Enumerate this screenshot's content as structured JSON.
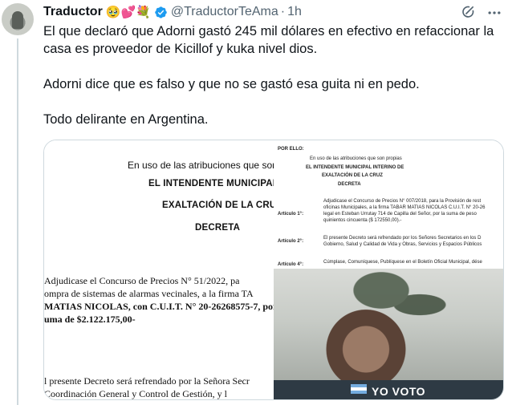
{
  "tweet": {
    "display_name": "Traductor",
    "name_emojis": "🥹💕💐",
    "handle": "@TraductorTeAma",
    "separator": "·",
    "time": "1h",
    "text": "El que declaró que Adorni gastó 245 mil dólares en efectivo en refaccionar la casa es proveedor de Kicillof y kuka nivel dios.\n\nAdorni dice que es falso y que no se gastó esa guita ni en pedo.\n\nTodo delirante en Argentina."
  },
  "media": {
    "left_doc": {
      "line1": "En uso de las atribuciones que son",
      "heading1": "EL INTENDENTE MUNICIPAL",
      "heading2": "EXALTACIÓN DE LA CRUZ",
      "heading3": "DECRETA",
      "body1": "Adjudicase el Concurso de Precios N° 51/2022, pa",
      "body2": "ompra de sistemas de alarmas vecinales, a la firma TA",
      "body3": "MATIAS NICOLAS, con C.U.I.T. N° 20-26268575-7, por",
      "body4": "uma de $2.122.175,00-",
      "body5": "l presente Decreto será refrendado por la Señora Secr",
      "body6": "Coordinación General y Control de Gestión, y l"
    },
    "right_doc": {
      "por_ello": "POR ELLO:",
      "atribuciones": "En uso de las atribuciones que son propias",
      "intendente": "EL INTENDENTE MUNICIPAL INTERINO DE",
      "exaltacion": "EXALTACIÓN DE LA CRUZ",
      "decreta": "DECRETA",
      "art1_label": "Artículo 1°:",
      "art1_l1": "Adjudicase el Concurso de Precios N° 007/2018, para la Provisión de rest",
      "art1_l2": "oficinas Municipales, a la firma TABAR MATIAS NICOLAS C.U.I.T. N° 20-26",
      "art1_l3": "legal en Esteban Urrutay 714 de Capilla del Señor, por la suma de peso",
      "art1_l4": "quinientos cincuenta ($ 172550,00).-",
      "art2_label": "Artículo 2°:",
      "art2_l1": "El presente Decreto será refrendado por los Señores Secretarios en los D",
      "art2_l2": "Gobierno, Salud y Calidad de Vida y Obras, Servicios y Espacios Públicos",
      "art3_label": "Artículo 4°:",
      "art3_l1": "Cúmplase, Comuníquese, Publíquese en el Boletín Oficial Municipal, dése"
    },
    "photo": {
      "caption": "YO VOTO"
    }
  },
  "colors": {
    "text": "#0f1419",
    "secondary": "#536471",
    "verified": "#1d9bf0",
    "border": "#cfd9de"
  },
  "icons": [
    "verified-badge-icon",
    "grok-icon",
    "more-icon"
  ]
}
